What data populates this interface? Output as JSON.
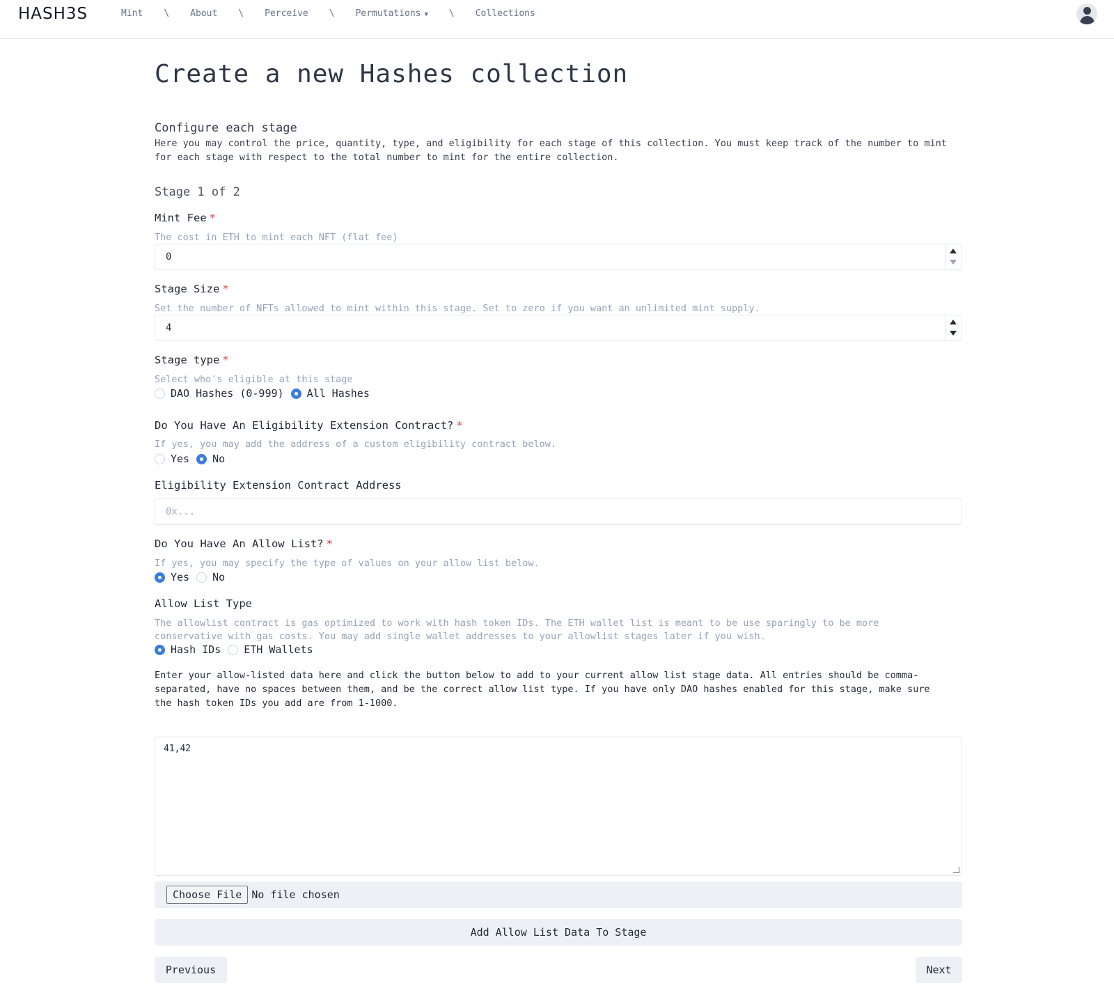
{
  "header": {
    "logo": "HASH3S",
    "nav": [
      {
        "label": "Mint"
      },
      {
        "label": "About"
      },
      {
        "label": "Perceive"
      },
      {
        "label": "Permutations",
        "has_dropdown": true
      },
      {
        "label": "Collections"
      }
    ],
    "separator": "\\"
  },
  "page": {
    "title": "Create a new Hashes collection",
    "section_title": "Configure each stage",
    "section_desc": "Here you may control the price, quantity, type, and eligibility for each stage of this collection. You must keep track of the number to mint for each stage with respect to the total number to mint for the entire collection.",
    "stage_label": "Stage 1 of 2"
  },
  "form": {
    "required_mark": "*",
    "mint_fee": {
      "label": "Mint Fee",
      "hint": "The cost in ETH to mint each NFT (flat fee)",
      "value": "0"
    },
    "stage_size": {
      "label": "Stage Size",
      "hint": "Set the number of NFTs allowed to mint within this stage. Set to zero if you want an unlimited mint supply.",
      "value": "4"
    },
    "stage_type": {
      "label": "Stage type",
      "hint": "Select who's eligible at this stage",
      "options": [
        "DAO Hashes (0-999)",
        "All Hashes"
      ],
      "selected": "All Hashes"
    },
    "eligibility_extension": {
      "label": "Do You Have An Eligibility Extension Contract?",
      "hint": "If yes, you may add the address of a custom eligibility contract below.",
      "options": [
        "Yes",
        "No"
      ],
      "selected": "No"
    },
    "eligibility_address": {
      "label": "Eligibility Extension Contract Address",
      "placeholder": "0x...",
      "value": ""
    },
    "allow_list": {
      "label": "Do You Have An Allow List?",
      "hint": "If yes, you may specify the type of values on your allow list below.",
      "options": [
        "Yes",
        "No"
      ],
      "selected": "Yes"
    },
    "allow_list_type": {
      "label": "Allow List Type",
      "hint": "The allowlist contract is gas optimized to work with hash token IDs. The ETH wallet list is meant to be use sparingly to be more conservative with gas costs. You may add single wallet addresses to your allowlist stages later if you wish.",
      "options": [
        "Hash IDs",
        "ETH Wallets"
      ],
      "selected": "Hash IDs"
    },
    "instructions": "Enter your allow-listed data here and click the button below to add to your current allow list stage data. All entries should be comma-separated, have no spaces between them, and be the correct allow list type. If you have only DAO hashes enabled for this stage, make sure the hash token IDs you add are from 1-1000.",
    "allow_list_data": "41,42",
    "file": {
      "button": "Choose File",
      "status": "No file chosen"
    },
    "add_button": "Add Allow List Data To Stage",
    "previous_button": "Previous",
    "next_button": "Next"
  },
  "colors": {
    "accent": "#3b7dd8",
    "required": "#e53e3e",
    "hint": "#94a3b8",
    "button_bg": "#edf1f5"
  }
}
